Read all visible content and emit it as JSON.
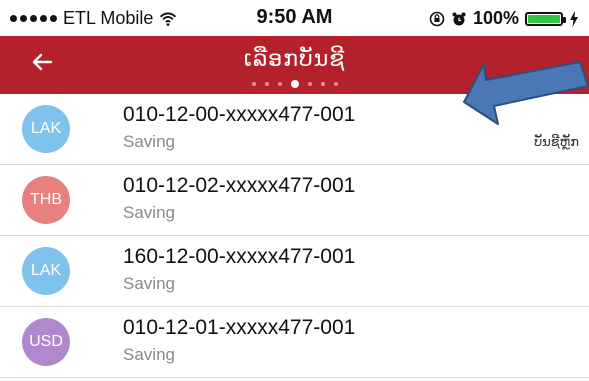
{
  "status_bar": {
    "carrier": "ETL Mobile",
    "time": "9:50 AM",
    "battery": "100%"
  },
  "header": {
    "title": "ເລືອກບັນຊີ",
    "back_icon": "arrow-left-icon"
  },
  "accounts": [
    {
      "currency": "LAK",
      "number": "010-12-00-xxxxx477-001",
      "type": "Saving",
      "tag": "ບັນຊີຫຼັກ",
      "color": "#7fc2ec"
    },
    {
      "currency": "THB",
      "number": "010-12-02-xxxxx477-001",
      "type": "Saving",
      "tag": "",
      "color": "#e88080"
    },
    {
      "currency": "LAK",
      "number": "160-12-00-xxxxx477-001",
      "type": "Saving",
      "tag": "",
      "color": "#7fc2ec"
    },
    {
      "currency": "USD",
      "number": "010-12-01-xxxxx477-001",
      "type": "Saving",
      "tag": "",
      "color": "#b088cc"
    }
  ],
  "colors": {
    "header_bg": "#b3212a",
    "battery_fill": "#2ec840",
    "arrow": "#4a78b5"
  }
}
